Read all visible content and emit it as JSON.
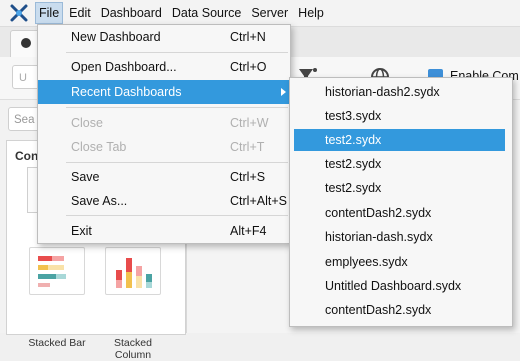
{
  "menubar": {
    "items": [
      "File",
      "Edit",
      "Dashboard",
      "Data Source",
      "Server",
      "Help"
    ]
  },
  "toolbar": {
    "enable_label": "Enable Com",
    "box_hint": "U"
  },
  "left_panel": {
    "search_placeholder": "Sea",
    "components_title": "Con",
    "tiles": [
      {
        "label_line1": "Stacked Bar",
        "label_line2": ""
      },
      {
        "label_line1": "Stacked",
        "label_line2": "Column"
      }
    ]
  },
  "file_menu": {
    "items": [
      {
        "label": "New Dashboard",
        "shortcut": "Ctrl+N",
        "disabled": false
      },
      {
        "label": "Open Dashboard...",
        "shortcut": "Ctrl+O",
        "disabled": false
      },
      {
        "label": "Recent Dashboards",
        "shortcut": "",
        "disabled": false
      },
      {
        "label": "Close",
        "shortcut": "Ctrl+W",
        "disabled": true
      },
      {
        "label": "Close Tab",
        "shortcut": "Ctrl+T",
        "disabled": true
      },
      {
        "label": "Save",
        "shortcut": "Ctrl+S",
        "disabled": false
      },
      {
        "label": "Save As...",
        "shortcut": "Ctrl+Alt+S",
        "disabled": false
      },
      {
        "label": "Exit",
        "shortcut": "Alt+F4",
        "disabled": false
      }
    ]
  },
  "recent_menu": {
    "items": [
      "historian-dash2.sydx",
      "test3.sydx",
      "test2.sydx",
      "test2.sydx",
      "test2.sydx",
      "contentDash2.sydx",
      "historian-dash.sydx",
      "emplyees.sydx",
      "Untitled Dashboard.sydx",
      "contentDash2.sydx"
    ],
    "selected_index": 2
  },
  "colors": {
    "highlight": "#3399dd",
    "menu_bg": "#f7f7f7"
  }
}
